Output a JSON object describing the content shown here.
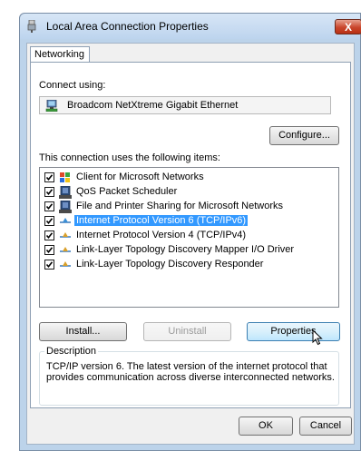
{
  "window": {
    "title": "Local Area Connection Properties",
    "close_glyph": "X"
  },
  "tabs": [
    {
      "label": "Networking"
    }
  ],
  "connect_using": {
    "label": "Connect using:",
    "adapter": "Broadcom NetXtreme Gigabit Ethernet",
    "configure_label": "Configure..."
  },
  "items_section": {
    "label": "This connection uses the following items:",
    "items": [
      {
        "label": "Client for Microsoft Networks",
        "checked": true,
        "icon": "network-client-icon",
        "selected": false
      },
      {
        "label": "QoS Packet Scheduler",
        "checked": true,
        "icon": "network-service-icon",
        "selected": false
      },
      {
        "label": "File and Printer Sharing for Microsoft Networks",
        "checked": true,
        "icon": "network-service-icon",
        "selected": false
      },
      {
        "label": "Internet Protocol Version 6 (TCP/IPv6)",
        "checked": true,
        "icon": "protocol-icon",
        "selected": true
      },
      {
        "label": "Internet Protocol Version 4 (TCP/IPv4)",
        "checked": true,
        "icon": "protocol-icon",
        "selected": false
      },
      {
        "label": "Link-Layer Topology Discovery Mapper I/O Driver",
        "checked": true,
        "icon": "protocol-icon",
        "selected": false
      },
      {
        "label": "Link-Layer Topology Discovery Responder",
        "checked": true,
        "icon": "protocol-icon",
        "selected": false
      }
    ]
  },
  "buttons": {
    "install": "Install...",
    "uninstall": "Uninstall",
    "properties": "Properties"
  },
  "description": {
    "legend": "Description",
    "text": "TCP/IP version 6. The latest version of the internet protocol that provides communication across diverse interconnected networks."
  },
  "footer": {
    "ok": "OK",
    "cancel": "Cancel"
  },
  "colors": {
    "selection": "#3399ff",
    "title_bar": "#bcd3ea",
    "close_button": "#c9462c"
  }
}
